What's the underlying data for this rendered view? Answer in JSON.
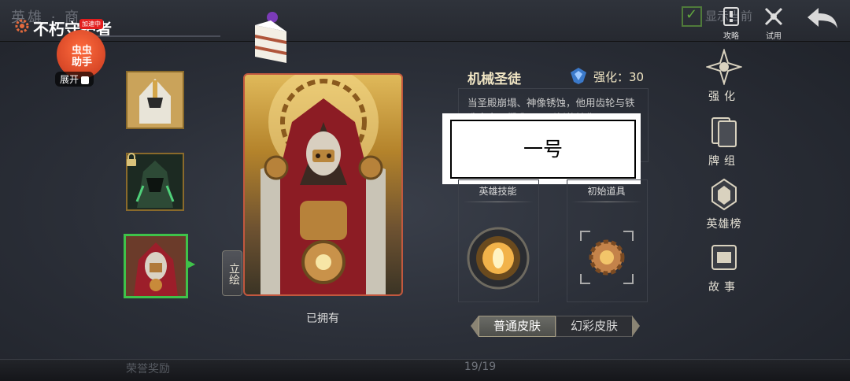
{
  "header": {
    "ghost_title": "英雄 · 商",
    "hero_name": "不朽守护者",
    "show_equipped": "显示当前",
    "guide_label": "攻略",
    "trial_label": "试用"
  },
  "helper": {
    "text": "虫虫\n助手",
    "badge": "加速中",
    "expand_label": "展开"
  },
  "card": {
    "owned_label": "已拥有",
    "portrait_toggle": "立绘"
  },
  "hero_info": {
    "title": "机械圣徒",
    "enhance_label": "强化：30",
    "description": "当圣殿崩塌、神像锈蚀，他用齿轮与铁造出自己们造了一副新的神像",
    "tag": "一号"
  },
  "slots": {
    "skill_label": "英雄技能",
    "item_label": "初始道具"
  },
  "skins": {
    "normal": "普通皮肤",
    "rainbow": "幻彩皮肤"
  },
  "nav": {
    "enhance": "强化",
    "deck": "牌组",
    "ranking": "英雄榜",
    "story": "故事"
  },
  "footer": {
    "page": "19/19",
    "reward": "荣誉奖励"
  },
  "colors": {
    "accent_gold": "#d4a64a",
    "selected_green": "#3fc24a",
    "card_border": "#c2583f"
  }
}
